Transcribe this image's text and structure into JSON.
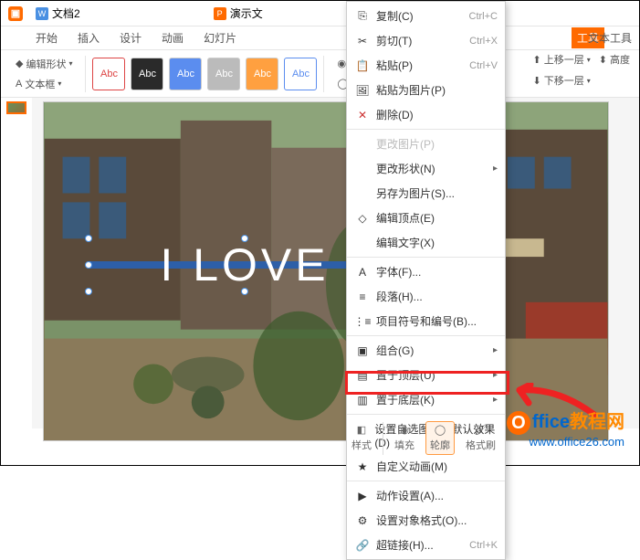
{
  "title": {
    "doc1_label": "文档2",
    "doc2_label": "演示文"
  },
  "ribbon": {
    "start": "开始",
    "insert": "插入",
    "design": "设计",
    "anim": "动画",
    "slide": "幻灯片",
    "tools": "工具",
    "texttools": "文本工具"
  },
  "toolbar": {
    "edit_shape": "编辑形状",
    "textbox": "文本框",
    "abc": "Abc",
    "fill": "填充",
    "outline": "轮廓",
    "up_layer": "上移一层",
    "down_layer": "下移一层",
    "height": "高度"
  },
  "slide": {
    "text": "I LOVE"
  },
  "ctx": {
    "copy": "复制(C)",
    "copy_sc": "Ctrl+C",
    "cut": "剪切(T)",
    "cut_sc": "Ctrl+X",
    "paste": "粘贴(P)",
    "paste_sc": "Ctrl+V",
    "paste_pic": "粘贴为图片(P)",
    "delete": "删除(D)",
    "change_pic": "更改图片(P)",
    "change_shape": "更改形状(N)",
    "save_as_pic": "另存为图片(S)...",
    "edit_vertex": "编辑顶点(E)",
    "edit_text": "编辑文字(X)",
    "font": "字体(F)...",
    "paragraph": "段落(H)...",
    "bullets": "项目符号和编号(B)...",
    "group": "组合(G)",
    "to_top": "置于顶层(U)",
    "to_bottom": "置于底层(K)",
    "default_shape": "设置自选图形的默认效果(D)",
    "custom_anim": "自定义动画(M)",
    "action": "动作设置(A)...",
    "format_obj": "设置对象格式(O)...",
    "hyperlink": "超链接(H)...",
    "hyperlink_sc": "Ctrl+K"
  },
  "bottom": {
    "style": "样式",
    "fill": "填充",
    "outline": "轮廓",
    "format_painter": "格式刷"
  },
  "watermark": {
    "brand1": "ffice",
    "brand2": "教程网",
    "url": "www.office26.com",
    "o": "O"
  }
}
